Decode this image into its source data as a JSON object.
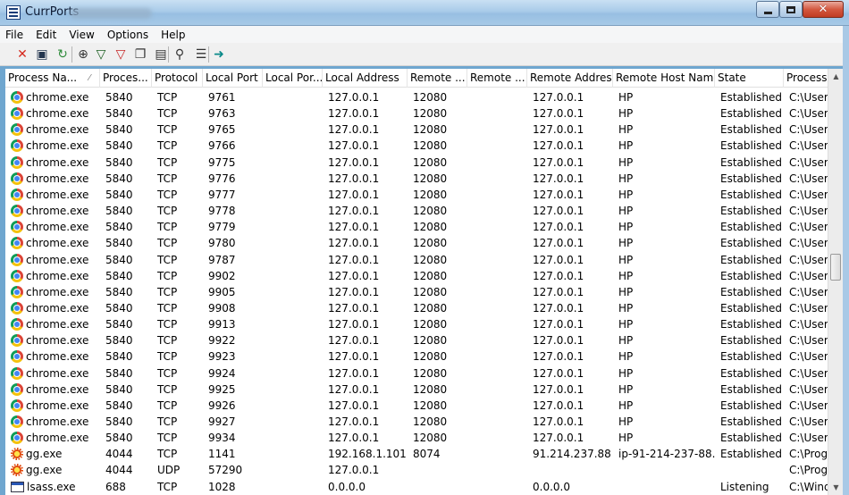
{
  "window": {
    "title": "CurrPorts"
  },
  "menu": [
    "File",
    "Edit",
    "View",
    "Options",
    "Help"
  ],
  "toolbar": [
    {
      "name": "close-connections-icon",
      "glyph": "✕",
      "color": "#d62a1e"
    },
    {
      "name": "save-icon",
      "glyph": "▣",
      "color": "#24364f"
    },
    {
      "name": "refresh-icon",
      "glyph": "↻",
      "color": "#2e8b3a"
    },
    {
      "name": "target-icon",
      "glyph": "⊕",
      "color": "#333333"
    },
    {
      "name": "filter-icon",
      "glyph": "▽",
      "color": "#1b5e20"
    },
    {
      "name": "filter-red-icon",
      "glyph": "▽",
      "color": "#c62828"
    },
    {
      "name": "copy-icon",
      "glyph": "❐",
      "color": "#333333"
    },
    {
      "name": "properties-icon",
      "glyph": "▤",
      "color": "#333333"
    },
    {
      "name": "find-icon",
      "glyph": "⚲",
      "color": "#333333"
    },
    {
      "name": "report-icon",
      "glyph": "☰",
      "color": "#333333"
    },
    {
      "name": "exit-icon",
      "glyph": "➜",
      "color": "#0b8a8a"
    }
  ],
  "columns": [
    "Process Na...",
    "Proces...",
    "Protocol",
    "Local Port",
    "Local Por...",
    "Local Address",
    "Remote ...",
    "Remote ...",
    "Remote Address",
    "Remote Host Name",
    "State",
    "Process"
  ],
  "rows": [
    {
      "icon": "chrome",
      "name": "chrome.exe",
      "pid": "5840",
      "protocol": "TCP",
      "local_port": "9761",
      "local_port_name": "",
      "local_address": "127.0.0.1",
      "remote_port": "12080",
      "remote_port_name": "",
      "remote_address": "127.0.0.1",
      "remote_host": "HP",
      "state": "Established",
      "path": "C:\\Users"
    },
    {
      "icon": "chrome",
      "name": "chrome.exe",
      "pid": "5840",
      "protocol": "TCP",
      "local_port": "9763",
      "local_port_name": "",
      "local_address": "127.0.0.1",
      "remote_port": "12080",
      "remote_port_name": "",
      "remote_address": "127.0.0.1",
      "remote_host": "HP",
      "state": "Established",
      "path": "C:\\Users"
    },
    {
      "icon": "chrome",
      "name": "chrome.exe",
      "pid": "5840",
      "protocol": "TCP",
      "local_port": "9765",
      "local_port_name": "",
      "local_address": "127.0.0.1",
      "remote_port": "12080",
      "remote_port_name": "",
      "remote_address": "127.0.0.1",
      "remote_host": "HP",
      "state": "Established",
      "path": "C:\\Users"
    },
    {
      "icon": "chrome",
      "name": "chrome.exe",
      "pid": "5840",
      "protocol": "TCP",
      "local_port": "9766",
      "local_port_name": "",
      "local_address": "127.0.0.1",
      "remote_port": "12080",
      "remote_port_name": "",
      "remote_address": "127.0.0.1",
      "remote_host": "HP",
      "state": "Established",
      "path": "C:\\Users"
    },
    {
      "icon": "chrome",
      "name": "chrome.exe",
      "pid": "5840",
      "protocol": "TCP",
      "local_port": "9775",
      "local_port_name": "",
      "local_address": "127.0.0.1",
      "remote_port": "12080",
      "remote_port_name": "",
      "remote_address": "127.0.0.1",
      "remote_host": "HP",
      "state": "Established",
      "path": "C:\\Users"
    },
    {
      "icon": "chrome",
      "name": "chrome.exe",
      "pid": "5840",
      "protocol": "TCP",
      "local_port": "9776",
      "local_port_name": "",
      "local_address": "127.0.0.1",
      "remote_port": "12080",
      "remote_port_name": "",
      "remote_address": "127.0.0.1",
      "remote_host": "HP",
      "state": "Established",
      "path": "C:\\Users"
    },
    {
      "icon": "chrome",
      "name": "chrome.exe",
      "pid": "5840",
      "protocol": "TCP",
      "local_port": "9777",
      "local_port_name": "",
      "local_address": "127.0.0.1",
      "remote_port": "12080",
      "remote_port_name": "",
      "remote_address": "127.0.0.1",
      "remote_host": "HP",
      "state": "Established",
      "path": "C:\\Users"
    },
    {
      "icon": "chrome",
      "name": "chrome.exe",
      "pid": "5840",
      "protocol": "TCP",
      "local_port": "9778",
      "local_port_name": "",
      "local_address": "127.0.0.1",
      "remote_port": "12080",
      "remote_port_name": "",
      "remote_address": "127.0.0.1",
      "remote_host": "HP",
      "state": "Established",
      "path": "C:\\Users"
    },
    {
      "icon": "chrome",
      "name": "chrome.exe",
      "pid": "5840",
      "protocol": "TCP",
      "local_port": "9779",
      "local_port_name": "",
      "local_address": "127.0.0.1",
      "remote_port": "12080",
      "remote_port_name": "",
      "remote_address": "127.0.0.1",
      "remote_host": "HP",
      "state": "Established",
      "path": "C:\\Users"
    },
    {
      "icon": "chrome",
      "name": "chrome.exe",
      "pid": "5840",
      "protocol": "TCP",
      "local_port": "9780",
      "local_port_name": "",
      "local_address": "127.0.0.1",
      "remote_port": "12080",
      "remote_port_name": "",
      "remote_address": "127.0.0.1",
      "remote_host": "HP",
      "state": "Established",
      "path": "C:\\Users"
    },
    {
      "icon": "chrome",
      "name": "chrome.exe",
      "pid": "5840",
      "protocol": "TCP",
      "local_port": "9787",
      "local_port_name": "",
      "local_address": "127.0.0.1",
      "remote_port": "12080",
      "remote_port_name": "",
      "remote_address": "127.0.0.1",
      "remote_host": "HP",
      "state": "Established",
      "path": "C:\\Users"
    },
    {
      "icon": "chrome",
      "name": "chrome.exe",
      "pid": "5840",
      "protocol": "TCP",
      "local_port": "9902",
      "local_port_name": "",
      "local_address": "127.0.0.1",
      "remote_port": "12080",
      "remote_port_name": "",
      "remote_address": "127.0.0.1",
      "remote_host": "HP",
      "state": "Established",
      "path": "C:\\Users"
    },
    {
      "icon": "chrome",
      "name": "chrome.exe",
      "pid": "5840",
      "protocol": "TCP",
      "local_port": "9905",
      "local_port_name": "",
      "local_address": "127.0.0.1",
      "remote_port": "12080",
      "remote_port_name": "",
      "remote_address": "127.0.0.1",
      "remote_host": "HP",
      "state": "Established",
      "path": "C:\\Users"
    },
    {
      "icon": "chrome",
      "name": "chrome.exe",
      "pid": "5840",
      "protocol": "TCP",
      "local_port": "9908",
      "local_port_name": "",
      "local_address": "127.0.0.1",
      "remote_port": "12080",
      "remote_port_name": "",
      "remote_address": "127.0.0.1",
      "remote_host": "HP",
      "state": "Established",
      "path": "C:\\Users"
    },
    {
      "icon": "chrome",
      "name": "chrome.exe",
      "pid": "5840",
      "protocol": "TCP",
      "local_port": "9913",
      "local_port_name": "",
      "local_address": "127.0.0.1",
      "remote_port": "12080",
      "remote_port_name": "",
      "remote_address": "127.0.0.1",
      "remote_host": "HP",
      "state": "Established",
      "path": "C:\\Users"
    },
    {
      "icon": "chrome",
      "name": "chrome.exe",
      "pid": "5840",
      "protocol": "TCP",
      "local_port": "9922",
      "local_port_name": "",
      "local_address": "127.0.0.1",
      "remote_port": "12080",
      "remote_port_name": "",
      "remote_address": "127.0.0.1",
      "remote_host": "HP",
      "state": "Established",
      "path": "C:\\Users"
    },
    {
      "icon": "chrome",
      "name": "chrome.exe",
      "pid": "5840",
      "protocol": "TCP",
      "local_port": "9923",
      "local_port_name": "",
      "local_address": "127.0.0.1",
      "remote_port": "12080",
      "remote_port_name": "",
      "remote_address": "127.0.0.1",
      "remote_host": "HP",
      "state": "Established",
      "path": "C:\\Users"
    },
    {
      "icon": "chrome",
      "name": "chrome.exe",
      "pid": "5840",
      "protocol": "TCP",
      "local_port": "9924",
      "local_port_name": "",
      "local_address": "127.0.0.1",
      "remote_port": "12080",
      "remote_port_name": "",
      "remote_address": "127.0.0.1",
      "remote_host": "HP",
      "state": "Established",
      "path": "C:\\Users"
    },
    {
      "icon": "chrome",
      "name": "chrome.exe",
      "pid": "5840",
      "protocol": "TCP",
      "local_port": "9925",
      "local_port_name": "",
      "local_address": "127.0.0.1",
      "remote_port": "12080",
      "remote_port_name": "",
      "remote_address": "127.0.0.1",
      "remote_host": "HP",
      "state": "Established",
      "path": "C:\\Users"
    },
    {
      "icon": "chrome",
      "name": "chrome.exe",
      "pid": "5840",
      "protocol": "TCP",
      "local_port": "9926",
      "local_port_name": "",
      "local_address": "127.0.0.1",
      "remote_port": "12080",
      "remote_port_name": "",
      "remote_address": "127.0.0.1",
      "remote_host": "HP",
      "state": "Established",
      "path": "C:\\Users"
    },
    {
      "icon": "chrome",
      "name": "chrome.exe",
      "pid": "5840",
      "protocol": "TCP",
      "local_port": "9927",
      "local_port_name": "",
      "local_address": "127.0.0.1",
      "remote_port": "12080",
      "remote_port_name": "",
      "remote_address": "127.0.0.1",
      "remote_host": "HP",
      "state": "Established",
      "path": "C:\\Users"
    },
    {
      "icon": "chrome",
      "name": "chrome.exe",
      "pid": "5840",
      "protocol": "TCP",
      "local_port": "9934",
      "local_port_name": "",
      "local_address": "127.0.0.1",
      "remote_port": "12080",
      "remote_port_name": "",
      "remote_address": "127.0.0.1",
      "remote_host": "HP",
      "state": "Established",
      "path": "C:\\Users"
    },
    {
      "icon": "gg",
      "name": "gg.exe",
      "pid": "4044",
      "protocol": "TCP",
      "local_port": "1141",
      "local_port_name": "",
      "local_address": "192.168.1.101",
      "remote_port": "8074",
      "remote_port_name": "",
      "remote_address": "91.214.237.88",
      "remote_host": "ip-91-214-237-88....",
      "state": "Established",
      "path": "C:\\Progr"
    },
    {
      "icon": "gg",
      "name": "gg.exe",
      "pid": "4044",
      "protocol": "UDP",
      "local_port": "57290",
      "local_port_name": "",
      "local_address": "127.0.0.1",
      "remote_port": "",
      "remote_port_name": "",
      "remote_address": "",
      "remote_host": "",
      "state": "",
      "path": "C:\\Progr"
    },
    {
      "icon": "sys",
      "name": "lsass.exe",
      "pid": "688",
      "protocol": "TCP",
      "local_port": "1028",
      "local_port_name": "",
      "local_address": "0.0.0.0",
      "remote_port": "",
      "remote_port_name": "",
      "remote_address": "0.0.0.0",
      "remote_host": "",
      "state": "Listening",
      "path": "C:\\Wind"
    }
  ]
}
